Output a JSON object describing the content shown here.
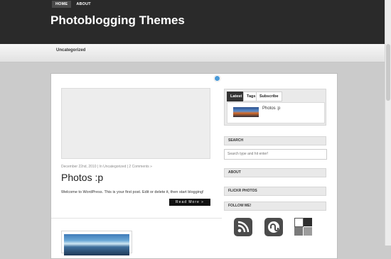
{
  "top_nav": {
    "items": [
      "HOME",
      "ABOUT"
    ]
  },
  "site": {
    "title": "Photoblogging Themes"
  },
  "categories": {
    "link": "Uncategorized"
  },
  "post": {
    "meta": "December 22nd, 2010 | In Uncategorized | 2 Comments »",
    "title": "Photos :p",
    "excerpt": "Welcome to WordPress. This is your first post. Edit or delete it, then start blogging!",
    "read_more": "Read More »"
  },
  "sidebar": {
    "tabs": [
      "Latest",
      "Tags",
      "Subscribe"
    ],
    "latest_item": "Photos :p",
    "search_heading": "SEARCH",
    "search_placeholder": "Search type and hit enter!",
    "about_heading": "ABOUT",
    "flickr_heading": "FLICKR PHOTOS",
    "follow_heading": "FOLLOW ME!",
    "social_icons": [
      "rss-icon",
      "stumbleupon-icon",
      "delicious-icon"
    ]
  },
  "colors": {
    "header_bg": "#2a2a2a",
    "button_bg": "#111111",
    "page_bg": "#cbcbcb"
  }
}
